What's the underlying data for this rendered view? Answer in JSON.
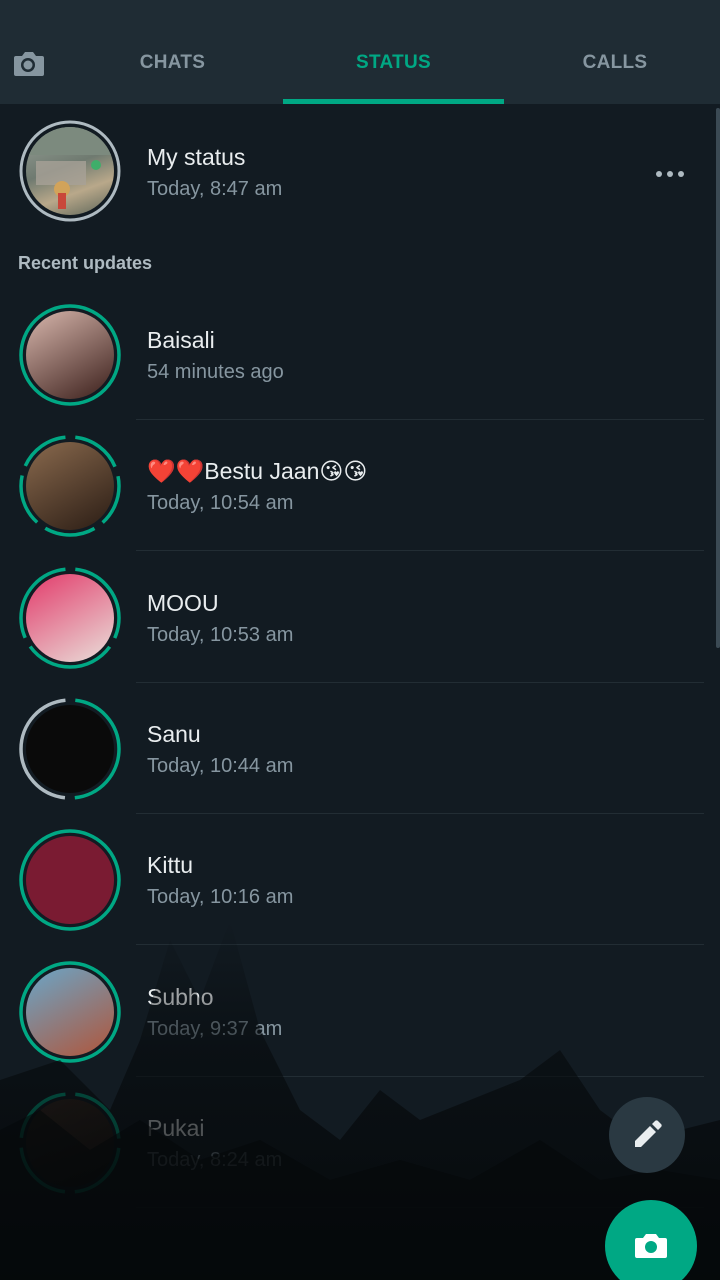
{
  "tabs": {
    "chats": "CHATS",
    "status": "STATUS",
    "calls": "CALLS",
    "camera_icon": "camera-icon"
  },
  "my_status": {
    "name": "My status",
    "time": "Today, 8:47 am",
    "menu_icon": "more-horizontal-icon"
  },
  "recent_label": "Recent updates",
  "updates": [
    {
      "name": "Baisali",
      "time": "54 minutes ago",
      "segments": 1,
      "avatar_colors": [
        "#d8b7ad",
        "#3a1e1a"
      ]
    },
    {
      "name": "❤️❤️Bestu Jaan😘😘",
      "time": "Today, 10:54 am",
      "segments": 5,
      "avatar_colors": [
        "#8a6a4e",
        "#2a1c14"
      ]
    },
    {
      "name": "MOOU",
      "time": "Today, 10:53 am",
      "segments": 3,
      "avatar_colors": [
        "#e23a6a",
        "#e9e0da"
      ]
    },
    {
      "name": "Sanu",
      "time": "Today, 10:44 am",
      "segments": 2,
      "avatar_colors": [
        "#0a0a0a",
        "#0a0a0a"
      ]
    },
    {
      "name": "Kittu",
      "time": "Today, 10:16 am",
      "segments": 1,
      "avatar_colors": [
        "#7a1b32",
        "#7a1b32"
      ]
    },
    {
      "name": "Subho",
      "time": "Today, 9:37 am",
      "segments": 1,
      "avatar_colors": [
        "#6aa6c8",
        "#b0553a"
      ]
    },
    {
      "name": "Pukai",
      "time": "Today, 8:24 am",
      "segments": 4,
      "avatar_colors": [
        "#3a2a22",
        "#1a1410"
      ]
    }
  ],
  "fab": {
    "pencil_icon": "pencil-icon",
    "camera_icon": "camera-icon"
  },
  "colors": {
    "accent": "#00a884",
    "background": "#121b22",
    "header": "#1f2c34",
    "secondary_text": "#8696a0"
  }
}
